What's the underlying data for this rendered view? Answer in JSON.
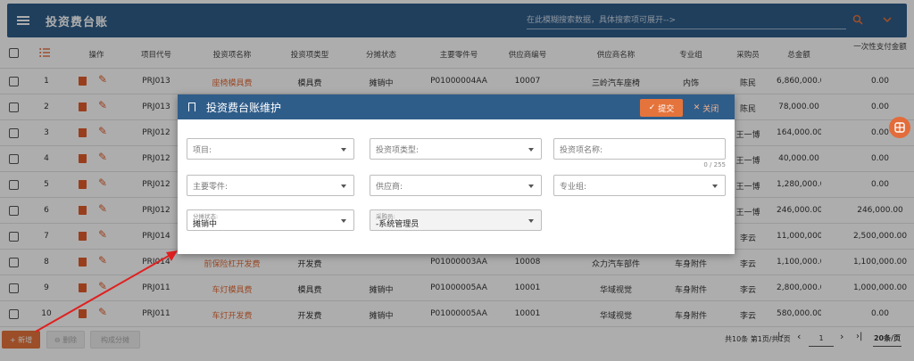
{
  "header": {
    "title": "投资费台账",
    "search_placeholder": "在此模糊搜索数据，具体搜索项可展开-->"
  },
  "table": {
    "headers": [
      "操作",
      "项目代号",
      "投资项名称",
      "投资项类型",
      "分摊状态",
      "主要零件号",
      "供应商编号",
      "供应商名称",
      "专业组",
      "采购员",
      "总金额",
      "一次性支付金额"
    ],
    "rows": [
      {
        "no": "1",
        "code": "PRJ013",
        "name": "座椅模具费",
        "type": "模具费",
        "status": "摊销中",
        "part": "P01000004AA",
        "sup_no": "10007",
        "sup_name": "三岭汽车座椅",
        "group": "内饰",
        "buyer": "陈民",
        "total": "6,860,000.00",
        "once": "0.00"
      },
      {
        "no": "2",
        "code": "PRJ013",
        "name": "",
        "type": "",
        "status": "",
        "part": "",
        "sup_no": "",
        "sup_name": "",
        "group": "",
        "buyer": "陈民",
        "total": "78,000.00",
        "once": "0.00"
      },
      {
        "no": "3",
        "code": "PRJ012",
        "name": "",
        "type": "",
        "status": "",
        "part": "",
        "sup_no": "",
        "sup_name": "",
        "group": "",
        "buyer": "王一博",
        "total": "164,000.00",
        "once": "0.00"
      },
      {
        "no": "4",
        "code": "PRJ012",
        "name": "",
        "type": "",
        "status": "",
        "part": "",
        "sup_no": "",
        "sup_name": "",
        "group": "",
        "buyer": "王一博",
        "total": "40,000.00",
        "once": "0.00"
      },
      {
        "no": "5",
        "code": "PRJ012",
        "name": "",
        "type": "",
        "status": "",
        "part": "",
        "sup_no": "",
        "sup_name": "",
        "group": "",
        "buyer": "王一博",
        "total": "1,280,000.00",
        "once": "0.00"
      },
      {
        "no": "6",
        "code": "PRJ012",
        "name": "",
        "type": "",
        "status": "",
        "part": "",
        "sup_no": "",
        "sup_name": "",
        "group": "",
        "buyer": "王一博",
        "total": "246,000.00",
        "once": "246,000.00"
      },
      {
        "no": "7",
        "code": "PRJ014",
        "name": "",
        "type": "",
        "status": "",
        "part": "",
        "sup_no": "",
        "sup_name": "",
        "group": "",
        "buyer": "李云",
        "total": "11,000,000.00",
        "once": "2,500,000.00"
      },
      {
        "no": "8",
        "code": "PRJ014",
        "name": "前保险杠开发费",
        "type": "开发费",
        "status": "",
        "part": "P01000003AA",
        "sup_no": "10008",
        "sup_name": "众力汽车部件",
        "group": "车身附件",
        "buyer": "李云",
        "total": "1,100,000.00",
        "once": "1,100,000.00"
      },
      {
        "no": "9",
        "code": "PRJ011",
        "name": "车灯模具费",
        "type": "模具费",
        "status": "摊销中",
        "part": "P01000005AA",
        "sup_no": "10001",
        "sup_name": "华域视觉",
        "group": "车身附件",
        "buyer": "李云",
        "total": "2,800,000.00",
        "once": "1,000,000.00"
      },
      {
        "no": "10",
        "code": "PRJ011",
        "name": "车灯开发费",
        "type": "开发费",
        "status": "摊销中",
        "part": "P01000005AA",
        "sup_no": "10001",
        "sup_name": "华域视觉",
        "group": "车身附件",
        "buyer": "李云",
        "total": "580,000.00",
        "once": "0.00"
      }
    ]
  },
  "dialog": {
    "title": "投资费台账维护",
    "submit_label": "提交",
    "close_label": "关闭",
    "fields": {
      "project": "项目:",
      "invest_type": "投资项类型:",
      "invest_name": "投资项名称:",
      "counter": "0 / 255",
      "main_part": "主要零件:",
      "supplier": "供应商:",
      "group": "专业组:",
      "status_label": "分摊状态:",
      "status_value": "摊销中",
      "buyer_label": "采购员:",
      "buyer_value": "-系统管理员"
    }
  },
  "footer": {
    "add_label": "+ 新增",
    "delete_label": "删除",
    "calc_label": "构成分摊",
    "summary": "共10条 第1页/共1页",
    "page": "1",
    "per_page": "20条/页"
  },
  "colors": {
    "primary": "#2f5d8a",
    "accent": "#e36c3a"
  }
}
